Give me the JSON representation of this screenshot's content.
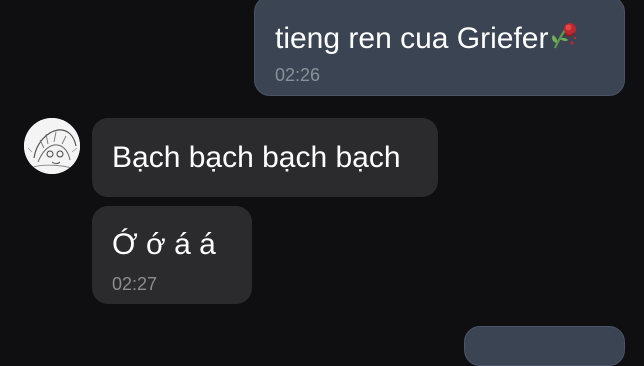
{
  "chat": {
    "messages": [
      {
        "direction": "outgoing",
        "text": "tieng ren cua Griefer",
        "emoji": "wilted-rose",
        "time": "02:26"
      },
      {
        "direction": "incoming",
        "text": "Bạch bạch bạch bạch",
        "time": ""
      },
      {
        "direction": "incoming",
        "text": "Ớ ớ á á",
        "time": "02:27"
      },
      {
        "direction": "outgoing",
        "text": "",
        "time": ""
      }
    ],
    "sender_avatar": "sketch-avatar"
  },
  "colors": {
    "background": "#0f0e10",
    "outgoing_bubble": "#3b4453",
    "incoming_bubble": "#2b2b2d",
    "timestamp": "#8a9099",
    "text": "#ffffff"
  }
}
